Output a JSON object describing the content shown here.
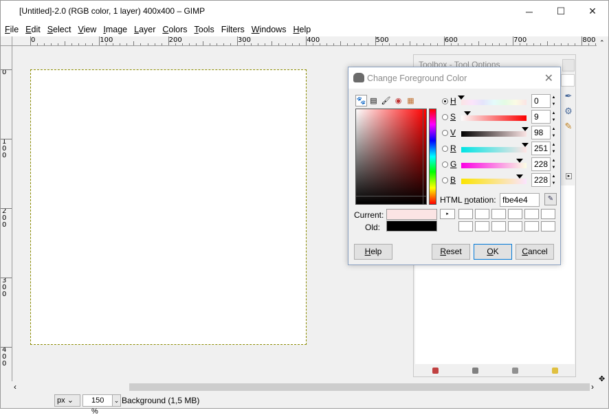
{
  "window": {
    "title": "[Untitled]-2.0 (RGB color, 1 layer) 400x400 – GIMP",
    "controls": [
      "─",
      "☐",
      "✕"
    ]
  },
  "menubar": [
    {
      "accel": "F",
      "rest": "ile"
    },
    {
      "accel": "E",
      "rest": "dit"
    },
    {
      "accel": "S",
      "rest": "elect"
    },
    {
      "accel": "V",
      "rest": "iew"
    },
    {
      "accel": "I",
      "rest": "mage"
    },
    {
      "accel": "L",
      "rest": "ayer"
    },
    {
      "accel": "C",
      "rest": "olors"
    },
    {
      "accel": "T",
      "rest": "ools"
    },
    {
      "accel": "",
      "rest": "Filters"
    },
    {
      "accel": "W",
      "rest": "indows"
    },
    {
      "accel": "H",
      "rest": "elp"
    }
  ],
  "ruler_top_labels": [
    "0",
    "100",
    "200",
    "300",
    "400",
    "500",
    "600",
    "700",
    "800"
  ],
  "ruler_left_labels": [
    "0",
    "100",
    "200",
    "300",
    "400"
  ],
  "statusbar": {
    "unit": "px",
    "zoom": "150 %",
    "info": "Background (1,5 MB)"
  },
  "toolbox": {
    "title": "Toolbox - Tool Options"
  },
  "dialog": {
    "title": "Change Foreground Color",
    "channels": [
      {
        "label": "H",
        "value": "0",
        "selected": true,
        "level": 0.0,
        "gradient": "linear-gradient(to right, #fbe4e4, #fbe4fb, #e4e4fb, #e4fbfb, #e4fbe4, #fbfbe4, #fbe4e4)"
      },
      {
        "label": "S",
        "value": "9",
        "selected": false,
        "level": 0.09,
        "gradient": "linear-gradient(to right, #fbfbfb, #fb0000)"
      },
      {
        "label": "V",
        "value": "98",
        "selected": false,
        "level": 0.98,
        "gradient": "linear-gradient(to right, #000000, #fbe4e4)"
      },
      {
        "label": "R",
        "value": "251",
        "selected": false,
        "level": 0.98,
        "gradient": "linear-gradient(to right, #00e4e4, #ffe4e4)"
      },
      {
        "label": "G",
        "value": "228",
        "selected": false,
        "level": 0.89,
        "gradient": "linear-gradient(to right, #fb00e4, #fbffe4)"
      },
      {
        "label": "B",
        "value": "228",
        "selected": false,
        "level": 0.89,
        "gradient": "linear-gradient(to right, #fbe400, #fbe4ff)"
      }
    ],
    "html_label_pre": "HTML ",
    "html_label_accel": "n",
    "html_label_post": "otation:",
    "html_value": "fbe4e4",
    "current_label": "Current:",
    "old_label": "Old:",
    "current_color": "#fbe4e4",
    "old_color": "#000000",
    "buttons": {
      "help": {
        "accel": "H",
        "rest": "elp"
      },
      "reset": {
        "accel": "R",
        "rest": "eset"
      },
      "ok": {
        "accel": "O",
        "rest": "K"
      },
      "cancel": {
        "accel": "C",
        "rest": "ancel"
      }
    }
  }
}
